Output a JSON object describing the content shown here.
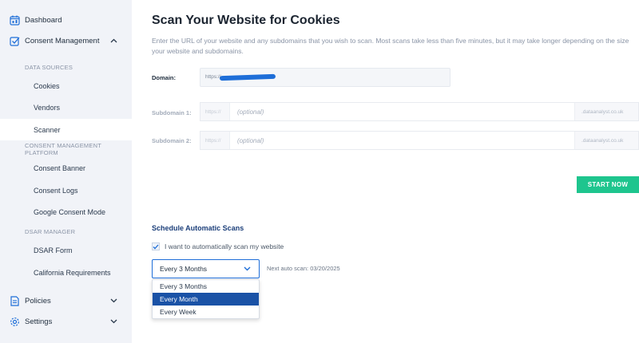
{
  "sidebar": {
    "dashboard": "Dashboard",
    "consent_management": "Consent Management",
    "sections": {
      "data_sources": "DATA SOURCES",
      "cmp": "CONSENT MANAGEMENT PLATFORM",
      "dsar": "DSAR MANAGER"
    },
    "items": {
      "cookies": "Cookies",
      "vendors": "Vendors",
      "scanner": "Scanner",
      "consent_banner": "Consent Banner",
      "consent_logs": "Consent Logs",
      "google_consent_mode": "Google Consent Mode",
      "dsar_form": "DSAR Form",
      "california": "California Requirements"
    },
    "policies": "Policies",
    "settings": "Settings",
    "active_item": "Scanner"
  },
  "main": {
    "title": "Scan Your Website for Cookies",
    "intro": "Enter the URL of your website and any subdomains that you wish to scan. Most scans take less than five minutes, but it may take longer depending on the size your website and subdomains.",
    "domain": {
      "label": "Domain:",
      "prefix": "https://"
    },
    "subdomain1": {
      "label": "Subdomain 1:",
      "prefix": "https://",
      "placeholder": "(optional)",
      "suffix": ".dataanalyst.co.uk"
    },
    "subdomain2": {
      "label": "Subdomain 2:",
      "prefix": "https://",
      "placeholder": "(optional)",
      "suffix": ".dataanalyst.co.uk"
    },
    "start_button": "START NOW",
    "schedule": {
      "title": "Schedule Automatic Scans",
      "checkbox_label": "I want to automatically scan my website",
      "checked": true,
      "selected_frequency": "Every 3 Months",
      "next_scan": "Next auto scan: 03/20/2025",
      "options": [
        "Every 3 Months",
        "Every Month",
        "Every Week"
      ],
      "highlighted_option": "Every Month"
    }
  },
  "colors": {
    "accent_green": "#1ec58e",
    "accent_blue": "#1e6ed8",
    "dropdown_highlight": "#1a52a6",
    "sidebar_bg": "#f1f3f8"
  }
}
